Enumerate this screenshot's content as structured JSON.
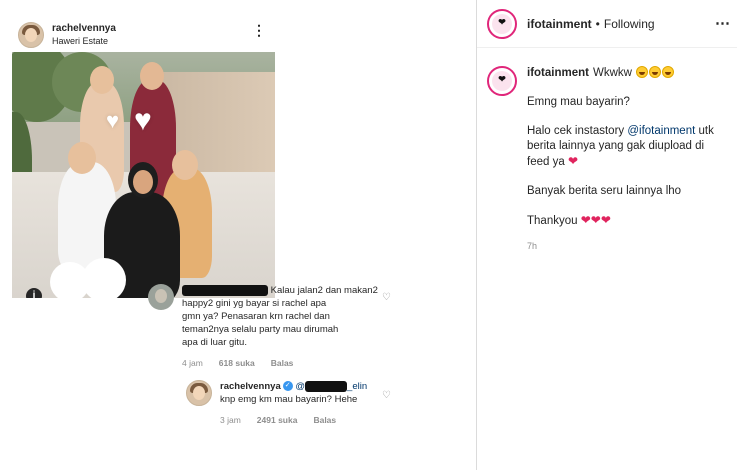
{
  "post_screenshot": {
    "username": "rachelvennya",
    "location": "Haweri Estate",
    "more_icon": "⋮",
    "info_icon": "i",
    "comments": [
      {
        "lines": [
          "Kalau jalan2 dan makan2",
          "happy2 gini yg bayar si rachel apa",
          "gmn ya? Penasaran krn rachel dan",
          "teman2nya selalu party mau dirumah",
          "apa di luar gitu."
        ],
        "time": "4 jam",
        "likes": "618 suka",
        "reply": "Balas"
      },
      {
        "username": "rachelvennya",
        "mention_prefix": "@",
        "mention_suffix": "_elin",
        "text": "knp emg km mau bayarin? Hehe",
        "time": "3 jam",
        "likes": "2491 suka",
        "reply": "Balas"
      }
    ]
  },
  "header": {
    "username": "ifotainment",
    "separator": "•",
    "follow_status": "Following",
    "more_icon": "⋯"
  },
  "caption": {
    "username": "ifotainment",
    "line1": "Wkwkw",
    "line2": "Emng mau bayarin?",
    "line3_pre": "Halo cek instastory ",
    "line3_mention": "@ifotainment",
    "line3_post": " utk berita lainnya yang gak diupload di feed ya",
    "line4": "Banyak berita seru lainnya lho",
    "line5": "Thankyou",
    "time_ago": "7h"
  },
  "colors": {
    "heart": "#e0245e",
    "mention": "#00376b",
    "verified": "#3897f0"
  }
}
